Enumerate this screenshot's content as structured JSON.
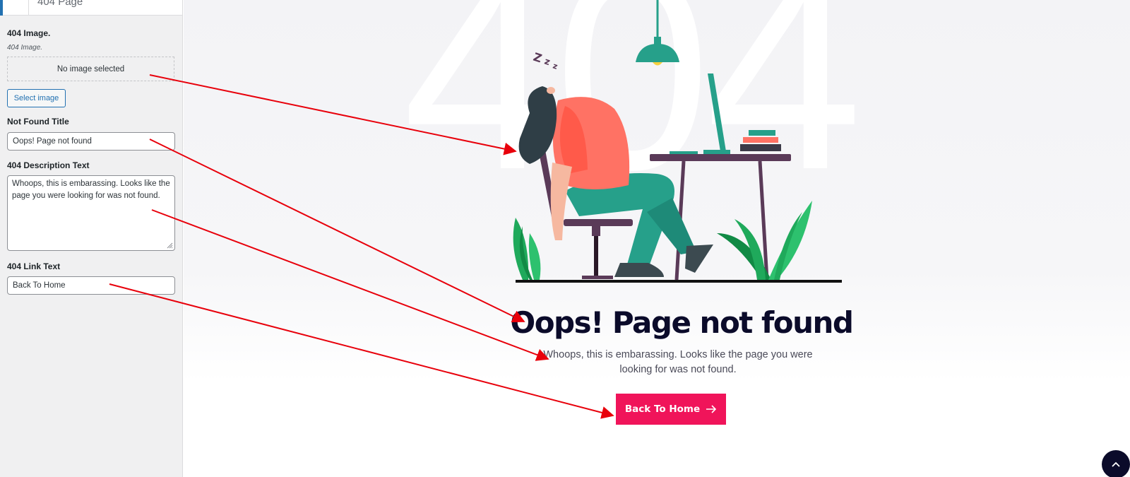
{
  "panel": {
    "section_title": "404 Page",
    "image_label": "404 Image.",
    "image_sublabel": "404 Image.",
    "no_image_text": "No image selected",
    "select_image_button": "Select image",
    "title_label": "Not Found Title",
    "title_value": "Oops! Page not found",
    "desc_label": "404 Description Text",
    "desc_value": "Whoops, this is embarassing. Looks like the page you were looking for was not found.",
    "link_label": "404 Link Text",
    "link_value": "Back To Home"
  },
  "preview": {
    "background_number": "404",
    "title": "Oops! Page not found",
    "description": "Whoops, this is embarassing. Looks like the page you were looking for was not found.",
    "button_label": "Back To Home",
    "button_icon": "arrow-right-icon",
    "scroll_top_icon": "chevron-up-icon"
  },
  "colors": {
    "wp_accent": "#2271b1",
    "button_bg": "#f0145a",
    "title_color": "#0b0b2a",
    "annotation_arrow": "#e8000b"
  }
}
